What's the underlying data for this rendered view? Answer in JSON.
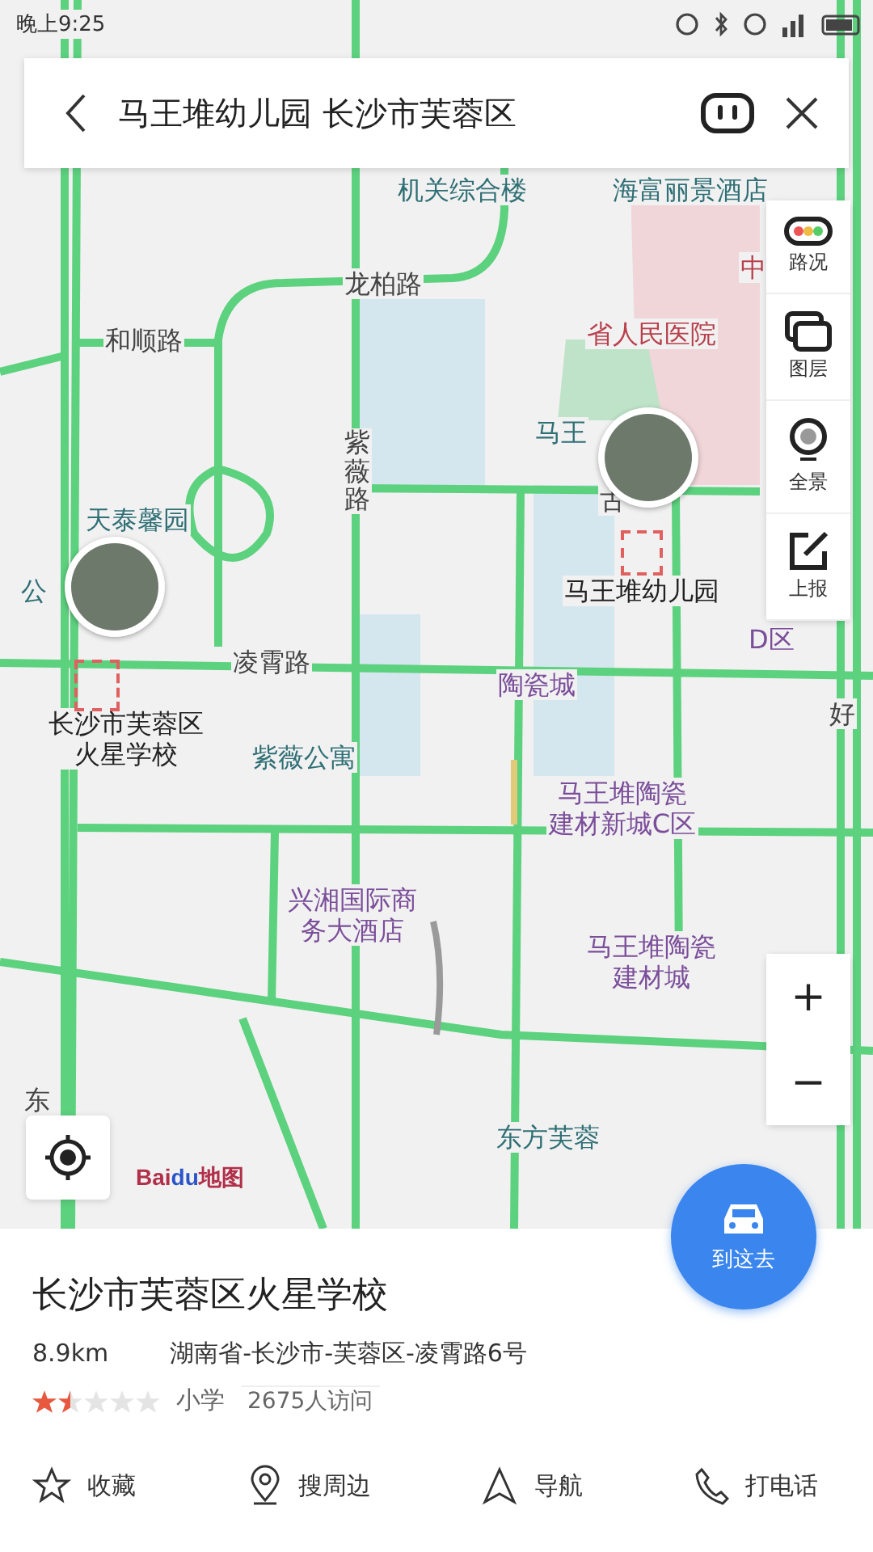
{
  "status_bar": {
    "time": "晚上9:25"
  },
  "search": {
    "query": "马王堆幼儿园 长沙市芙蓉区"
  },
  "map": {
    "labels": [
      {
        "text": "机关综合楼",
        "kind": "place"
      },
      {
        "text": "海富丽景酒店",
        "kind": "place"
      },
      {
        "text": "龙柏路",
        "kind": "road"
      },
      {
        "text": "和顺路",
        "kind": "road"
      },
      {
        "text": "中",
        "kind": "hospital"
      },
      {
        "text": "省人民医院",
        "kind": "hospital"
      },
      {
        "text": "紫薇路",
        "kind": "vroad"
      },
      {
        "text": "天泰馨园",
        "kind": "place"
      },
      {
        "text": "古",
        "kind": "road"
      },
      {
        "text": "马王",
        "kind": "place"
      },
      {
        "text": "马王堆幼儿园",
        "kind": "target"
      },
      {
        "text": "公",
        "kind": "place"
      },
      {
        "text": "凌霄路",
        "kind": "road"
      },
      {
        "text": "D区",
        "kind": "poi"
      },
      {
        "text": "陶瓷城",
        "kind": "poi"
      },
      {
        "text": "好",
        "kind": "road"
      },
      {
        "text": "长沙市芙蓉区火星学校",
        "kind": "target"
      },
      {
        "text": "紫薇公寓",
        "kind": "place"
      },
      {
        "text": "马王堆陶瓷建材新城C区",
        "kind": "poi"
      },
      {
        "text": "兴湘国际商务大酒店",
        "kind": "poi"
      },
      {
        "text": "马王堆陶瓷建材城",
        "kind": "poi"
      },
      {
        "text": "东",
        "kind": "road"
      },
      {
        "text": "东方芙蓉",
        "kind": "place"
      }
    ],
    "logo": {
      "text": "Bai",
      "accent": "du",
      "suffix": "地图"
    },
    "tools": [
      {
        "label": "路况"
      },
      {
        "label": "图层"
      },
      {
        "label": "全景"
      },
      {
        "label": "上报"
      }
    ],
    "zoom": {
      "plus": "+",
      "minus": "−"
    },
    "go_button": {
      "label": "到这去"
    }
  },
  "place": {
    "name": "长沙市芙蓉区火星学校",
    "distance": "8.9km",
    "address": "湖南省-长沙市-芙蓉区-凌霄路6号",
    "stars": 1.5,
    "category": "小学",
    "visits": "2675人访问"
  },
  "actions": [
    {
      "label": "收藏"
    },
    {
      "label": "搜周边"
    },
    {
      "label": "导航"
    },
    {
      "label": "打电话"
    }
  ]
}
